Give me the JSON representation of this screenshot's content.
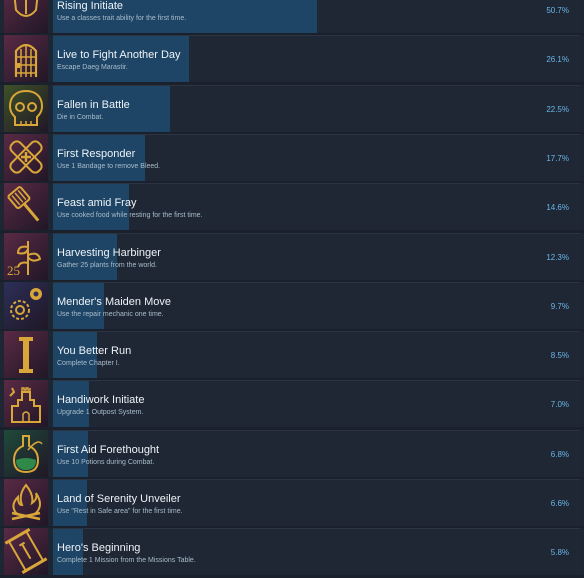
{
  "achievements": [
    {
      "title": "Rising Initiate",
      "description": "Use a classes trait ability for the first time.",
      "percent_label": "50.7%",
      "percent": 50.7,
      "icon": "shield-icon",
      "icon_bg": "#5a2a45"
    },
    {
      "title": "Live to Fight Another Day",
      "description": "Escape Daeg Marastir.",
      "percent_label": "26.1%",
      "percent": 26.1,
      "icon": "portcullis-icon",
      "icon_bg": "#5a2a45"
    },
    {
      "title": "Fallen in Battle",
      "description": "Die in Combat.",
      "percent_label": "22.5%",
      "percent": 22.5,
      "icon": "skull-icon",
      "icon_bg": "#3e5128"
    },
    {
      "title": "First Responder",
      "description": "Use 1 Bandage to remove Bleed.",
      "percent_label": "17.7%",
      "percent": 17.7,
      "icon": "bandage-icon",
      "icon_bg": "#5a2a45"
    },
    {
      "title": "Feast amid Fray",
      "description": "Use cooked food while resting for the first time.",
      "percent_label": "14.6%",
      "percent": 14.6,
      "icon": "spatula-icon",
      "icon_bg": "#5a2a45"
    },
    {
      "title": "Harvesting Harbinger",
      "description": "Gather 25 plants from the world.",
      "percent_label": "12.3%",
      "percent": 12.3,
      "icon": "plant-icon",
      "icon_bg": "#5a2a45",
      "badge": "25"
    },
    {
      "title": "Mender's Maiden Move",
      "description": "Use the repair mechanic one time.",
      "percent_label": "9.7%",
      "percent": 9.7,
      "icon": "gears-icon",
      "icon_bg": "#2c2f58"
    },
    {
      "title": "You Better Run",
      "description": "Complete Chapter I.",
      "percent_label": "8.5%",
      "percent": 8.5,
      "icon": "chapter-one-icon",
      "icon_bg": "#5a2a45"
    },
    {
      "title": "Handiwork Initiate",
      "description": "Upgrade 1 Outpost System.",
      "percent_label": "7.0%",
      "percent": 7.0,
      "icon": "castle-icon",
      "icon_bg": "#5a2a45"
    },
    {
      "title": "First Aid Forethought",
      "description": "Use 10 Potions during Combat.",
      "percent_label": "6.8%",
      "percent": 6.8,
      "icon": "potion-icon",
      "icon_bg": "#1f4a3a"
    },
    {
      "title": "Land of Serenity Unveiler",
      "description": "Use \"Rest in Safe area\" for the first time.",
      "percent_label": "6.6%",
      "percent": 6.6,
      "icon": "campfire-icon",
      "icon_bg": "#5a2a45"
    },
    {
      "title": "Hero's Beginning",
      "description": "Complete 1 Mission from the Missions Table.",
      "percent_label": "5.8%",
      "percent": 5.8,
      "icon": "scroll-icon",
      "icon_bg": "#5a2a45"
    }
  ]
}
